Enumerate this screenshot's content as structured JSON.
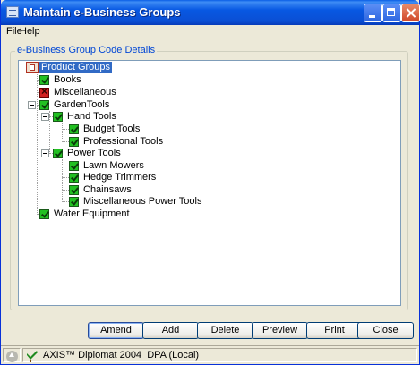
{
  "window": {
    "title": "Maintain e-Business Groups"
  },
  "menu": {
    "file": "File",
    "help": "Help"
  },
  "group_label": "e-Business Group Code Details",
  "tree": {
    "root": "Product Groups",
    "books": "Books",
    "miscellaneous": "Miscellaneous",
    "garden_tools": "GardenTools",
    "hand_tools": "Hand Tools",
    "budget_tools": "Budget Tools",
    "professional_tools": "Professional Tools",
    "power_tools": "Power Tools",
    "lawn_mowers": "Lawn Mowers",
    "hedge_trimmers": "Hedge Trimmers",
    "chainsaws": "Chainsaws",
    "misc_power_tools": "Miscellaneous Power Tools",
    "water_equipment": "Water Equipment"
  },
  "buttons": {
    "amend": "Amend",
    "add": "Add",
    "delete": "Delete",
    "preview": "Preview",
    "print": "Print",
    "close": "Close"
  },
  "status": {
    "product": "AXIS™ Diplomat 2004",
    "mode": "DPA (Local)"
  },
  "colors": {
    "titlebar": "#0a4fd4",
    "selection": "#316ac5",
    "checked": "#22c022",
    "excluded": "#d02020"
  }
}
